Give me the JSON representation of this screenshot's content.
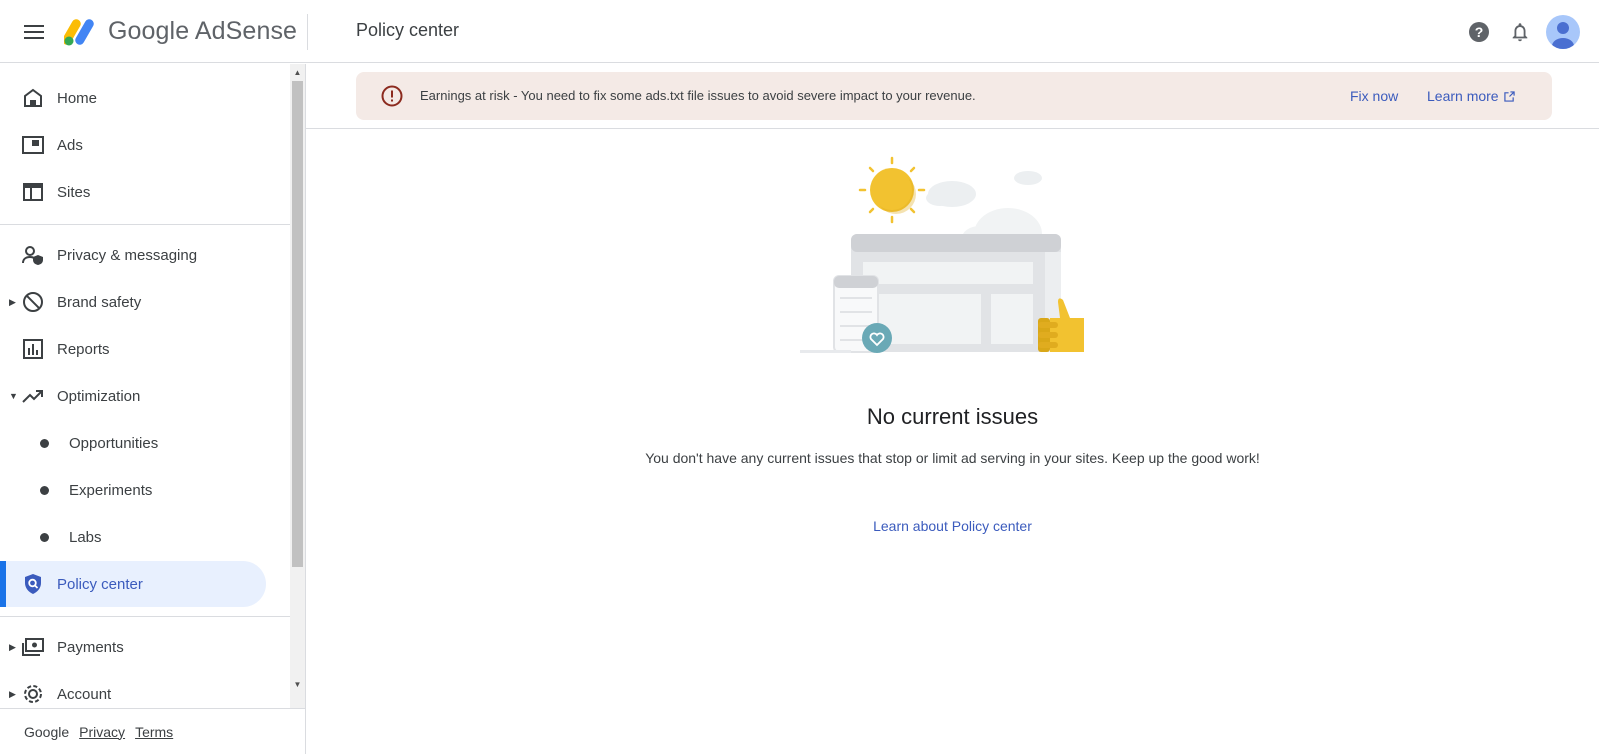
{
  "header": {
    "logo_text": "Google AdSense",
    "page_title": "Policy center"
  },
  "sidebar": {
    "items": [
      {
        "label": "Home",
        "icon": "home-icon"
      },
      {
        "label": "Ads",
        "icon": "ads-icon"
      },
      {
        "label": "Sites",
        "icon": "sites-icon"
      },
      {
        "label": "Privacy & messaging",
        "icon": "privacy-messaging-icon"
      },
      {
        "label": "Brand safety",
        "icon": "block-icon"
      },
      {
        "label": "Reports",
        "icon": "reports-icon"
      },
      {
        "label": "Optimization",
        "icon": "trending-up-icon"
      },
      {
        "label": "Opportunities"
      },
      {
        "label": "Experiments"
      },
      {
        "label": "Labs"
      },
      {
        "label": "Policy center",
        "icon": "policy-shield-icon",
        "active": true
      },
      {
        "label": "Payments",
        "icon": "payments-icon"
      },
      {
        "label": "Account",
        "icon": "gear-icon"
      }
    ],
    "footer": {
      "brand": "Google",
      "privacy": "Privacy",
      "terms": "Terms"
    }
  },
  "banner": {
    "message": "Earnings at risk - You need to fix some ads.txt file issues to avoid severe impact to your revenue.",
    "fix_now": "Fix now",
    "learn_more": "Learn more"
  },
  "empty_state": {
    "title": "No current issues",
    "description": "You don't have any current issues that stop or limit ad serving in your sites. Keep up the good work!",
    "link": "Learn about Policy center"
  },
  "colors": {
    "accent": "#3b5bbd",
    "active_bg": "#e8f0fe",
    "banner_bg": "#f4eae6",
    "warning": "#b3261e"
  }
}
